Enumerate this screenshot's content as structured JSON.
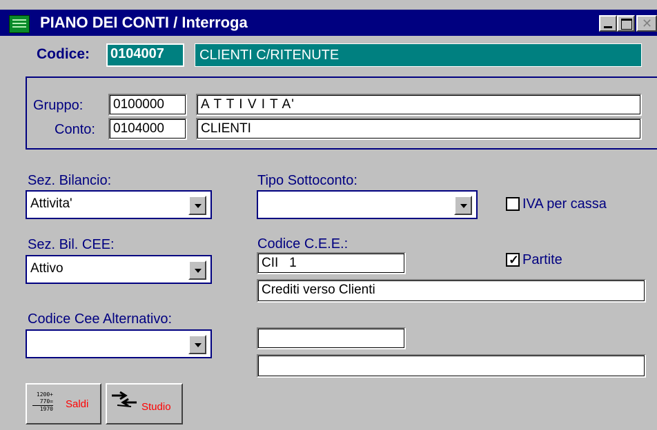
{
  "window": {
    "title": "PIANO DEI CONTI / Interroga"
  },
  "codice": {
    "label": "Codice:",
    "code": "0104007",
    "description": "CLIENTI C/RITENUTE"
  },
  "group": {
    "gruppo": {
      "label": "Gruppo:",
      "code": "0100000",
      "description": "A T T I V I T A'"
    },
    "conto": {
      "label": "Conto:",
      "code": "0104000",
      "description": "CLIENTI"
    }
  },
  "sez_bilancio": {
    "label": "Sez. Bilancio:",
    "value": "Attivita'"
  },
  "tipo_sottoconto": {
    "label": "Tipo Sottoconto:",
    "value": ""
  },
  "iva_per_cassa": {
    "label": "IVA per cassa",
    "checked": false
  },
  "sez_bil_cee": {
    "label": "Sez. Bil. CEE:",
    "value": "Attivo"
  },
  "codice_cee": {
    "label": "Codice C.E.E.:",
    "code": "CII   1",
    "description": "Crediti verso Clienti"
  },
  "partite": {
    "label": "Partite",
    "checked": true
  },
  "codice_cee_alt": {
    "label": "Codice Cee Alternativo:",
    "value": "",
    "code": "",
    "description": ""
  },
  "toolbar": {
    "saldi": {
      "label": "Saldi",
      "icon_lines": [
        "1200+",
        "770=",
        "1970"
      ]
    },
    "studio": {
      "label": "Studio"
    }
  },
  "colors": {
    "title_bg": "#000080",
    "label": "#000080",
    "teal": "#008080",
    "face": "#c0c0c0",
    "button_text": "#ff0000"
  }
}
